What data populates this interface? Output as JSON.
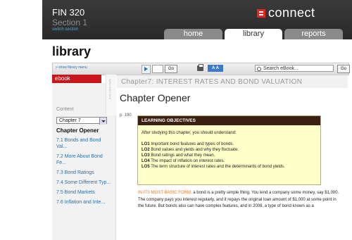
{
  "header": {
    "course": "FIN 320",
    "section": "Section 1",
    "switch_link": "switch section",
    "logo": "connect",
    "tabs": [
      {
        "label": "home"
      },
      {
        "label": "library"
      },
      {
        "label": "reports"
      }
    ]
  },
  "library_heading": "library",
  "toolbar": {
    "show_menu": "» show library menu",
    "go_label": "Go",
    "text_size": "A A",
    "search_placeholder": "Search eBook..."
  },
  "sidebar": {
    "ebook_tab": "ebook",
    "strip_label": "NAVIGATION",
    "contents_label": "Content",
    "chapter_select": "Chapter 7",
    "toc": [
      {
        "label": "Chapter Opener",
        "active": true
      },
      {
        "label": "7.1 Bonds and Bond Val...",
        "active": false
      },
      {
        "label": "7.2 More About Bond Fe...",
        "active": false
      },
      {
        "label": "7.3 Bond Ratings",
        "active": false
      },
      {
        "label": "7.4 Some Different Typ...",
        "active": false
      },
      {
        "label": "7.5 Bond Markets",
        "active": false
      },
      {
        "label": "7.6 Inflation and Inte...",
        "active": false
      }
    ]
  },
  "content": {
    "chapter_title": "Chapter7: INTEREST RATES AND BOND VALUATION",
    "section_heading": "Chapter Opener",
    "page_num": "p. 190",
    "lo_title": "LEARNING OBJECTIVES",
    "lo_intro": "After studying this chapter, you should understand:",
    "objectives": [
      {
        "code": "LO1",
        "text": "Important bond features and types of bonds."
      },
      {
        "code": "LO2",
        "text": "Bond values and yields and why they fluctuate."
      },
      {
        "code": "LO3",
        "text": "Bond ratings and what they mean."
      },
      {
        "code": "LO4",
        "text": "The impact of inflation on interest rates."
      },
      {
        "code": "LO5",
        "text": "The term structure of interest rates and the determinants of bond yields."
      }
    ],
    "body_lead": "IN ITS MOST BASIC FORM,",
    "body_text": " a bond is a pretty simple thing. You lend a company some money, say $1,000. The company pays you interest regularly, and it repays the original loan amount of $1,000 at some point in the future. But bonds also can have complex features, and in 2008, a type of bond known as a"
  },
  "colors": {
    "header_bg": "#2e2e2e",
    "accent_red": "#c8161d",
    "link_blue": "#2b6fb0",
    "lo_header_bg": "#3b1f10",
    "lo_box_bg": "#ffffc9",
    "lead_orange": "#e87722"
  }
}
